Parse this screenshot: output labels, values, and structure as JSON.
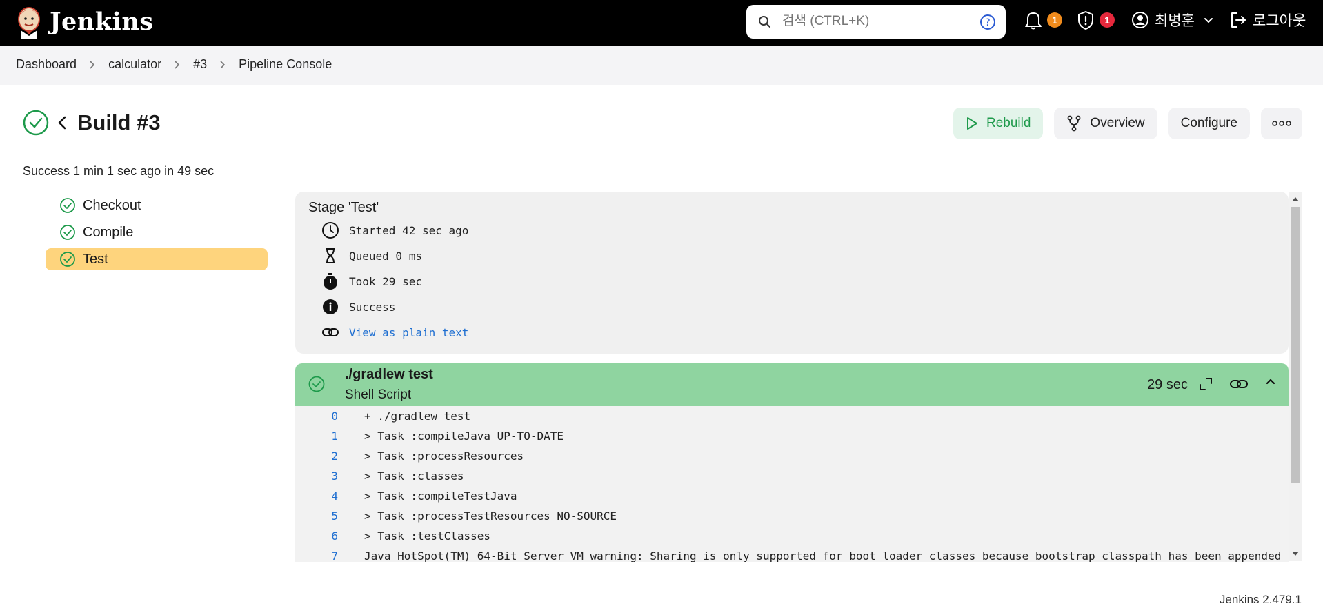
{
  "header": {
    "brand": "Jenkins",
    "search_placeholder": "검색 (CTRL+K)",
    "notifications_count": "1",
    "security_count": "1",
    "user_name": "최병훈",
    "logout_label": "로그아웃"
  },
  "breadcrumb": [
    "Dashboard",
    "calculator",
    "#3",
    "Pipeline Console"
  ],
  "build": {
    "title": "Build #3",
    "summary": "Success 1 min 1 sec ago in 49 sec"
  },
  "actions": {
    "rebuild": "Rebuild",
    "overview": "Overview",
    "configure": "Configure"
  },
  "stages": [
    {
      "label": "Checkout",
      "status": "success"
    },
    {
      "label": "Compile",
      "status": "success"
    },
    {
      "label": "Test",
      "status": "success",
      "selected": true
    }
  ],
  "stage_details": {
    "title": "Stage 'Test'",
    "started": "Started 42 sec ago",
    "queued": "Queued 0 ms",
    "took": "Took 29 sec",
    "status": "Success",
    "plain_text_link": "View as plain text"
  },
  "step": {
    "title": "./gradlew test",
    "subtitle": "Shell Script",
    "duration": "29 sec"
  },
  "console_lines": [
    {
      "n": "0",
      "text": "+ ./gradlew test"
    },
    {
      "n": "1",
      "text": "> Task :compileJava UP-TO-DATE"
    },
    {
      "n": "2",
      "text": "> Task :processResources"
    },
    {
      "n": "3",
      "text": "> Task :classes"
    },
    {
      "n": "4",
      "text": "> Task :compileTestJava"
    },
    {
      "n": "5",
      "text": "> Task :processTestResources NO-SOURCE"
    },
    {
      "n": "6",
      "text": "> Task :testClasses"
    },
    {
      "n": "7",
      "text": "Java HotSpot(TM) 64-Bit Server VM warning: Sharing is only supported for boot loader classes because bootstrap classpath has been appended"
    }
  ],
  "footer": {
    "version": "Jenkins 2.479.1"
  },
  "colors": {
    "success_green": "#1e9a4b",
    "step_header_green": "#8fd4a0",
    "selected_stage": "#fed47d",
    "link_blue": "#1f6fd1"
  }
}
